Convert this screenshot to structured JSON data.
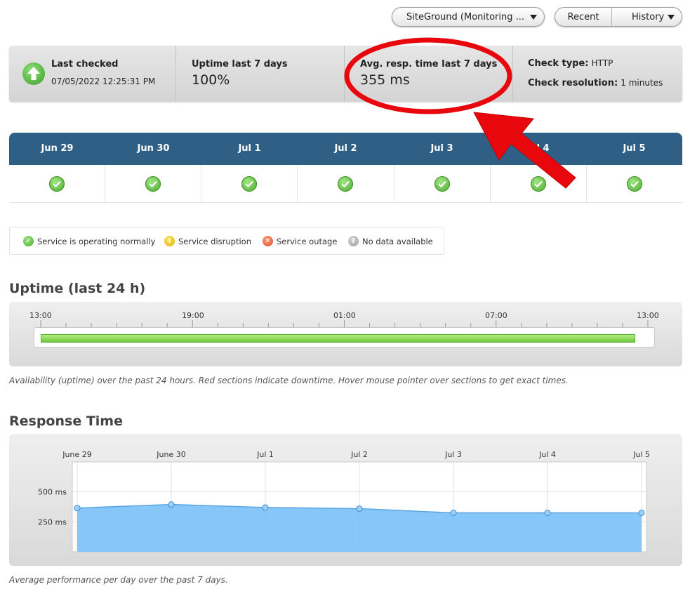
{
  "toolbar": {
    "monitor_select": "SiteGround (Monitoring ...",
    "recent_label": "Recent",
    "history_label": "History"
  },
  "summary": {
    "last_checked_label": "Last checked",
    "last_checked_value": "07/05/2022 12:25:31 PM",
    "uptime_label": "Uptime last 7 days",
    "uptime_value": "100%",
    "avg_label": "Avg. resp. time last 7 days",
    "avg_value": "355 ms",
    "check_type_label": "Check type:",
    "check_type_value": "HTTP",
    "check_res_label": "Check resolution:",
    "check_res_value": "1 minutes"
  },
  "calendar": {
    "days": [
      "Jun 29",
      "Jun 30",
      "Jul 1",
      "Jul 2",
      "Jul 3",
      "Jul 4",
      "Jul 5"
    ],
    "statuses": [
      "ok",
      "ok",
      "ok",
      "ok",
      "ok",
      "ok",
      "ok"
    ]
  },
  "legend": {
    "normal": "Service is operating normally",
    "disruption": "Service disruption",
    "outage": "Service outage",
    "no_data": "No data available"
  },
  "uptime_section": {
    "title": "Uptime (last 24 h)",
    "time_labels": [
      "13:00",
      "19:00",
      "01:00",
      "07:00",
      "13:00"
    ],
    "availability_fraction": 1.0,
    "caption": "Availability (uptime) over the past 24 hours. Red sections indicate downtime. Hover mouse pointer over sections to get exact times."
  },
  "response_section": {
    "title": "Response Time",
    "caption": "Average performance per day over the past 7 days."
  },
  "chart_data": {
    "type": "area",
    "categories": [
      "June 29",
      "June 30",
      "Jul 1",
      "Jul 2",
      "Jul 3",
      "Jul 4",
      "Jul 5"
    ],
    "series": [
      {
        "values": [
          365,
          395,
          370,
          360,
          325,
          325,
          325
        ]
      }
    ],
    "ytick_labels": [
      "500 ms",
      "250 ms"
    ],
    "yticks": [
      500,
      250
    ],
    "ylim": [
      0,
      750
    ],
    "grid": true,
    "colors": {
      "fill": "#79c0f7",
      "line": "#5aa6e3"
    }
  },
  "colors": {
    "calendar_header": "#2f5f85",
    "annotation": "#e8070c",
    "ok_green": "#4aa92d"
  }
}
